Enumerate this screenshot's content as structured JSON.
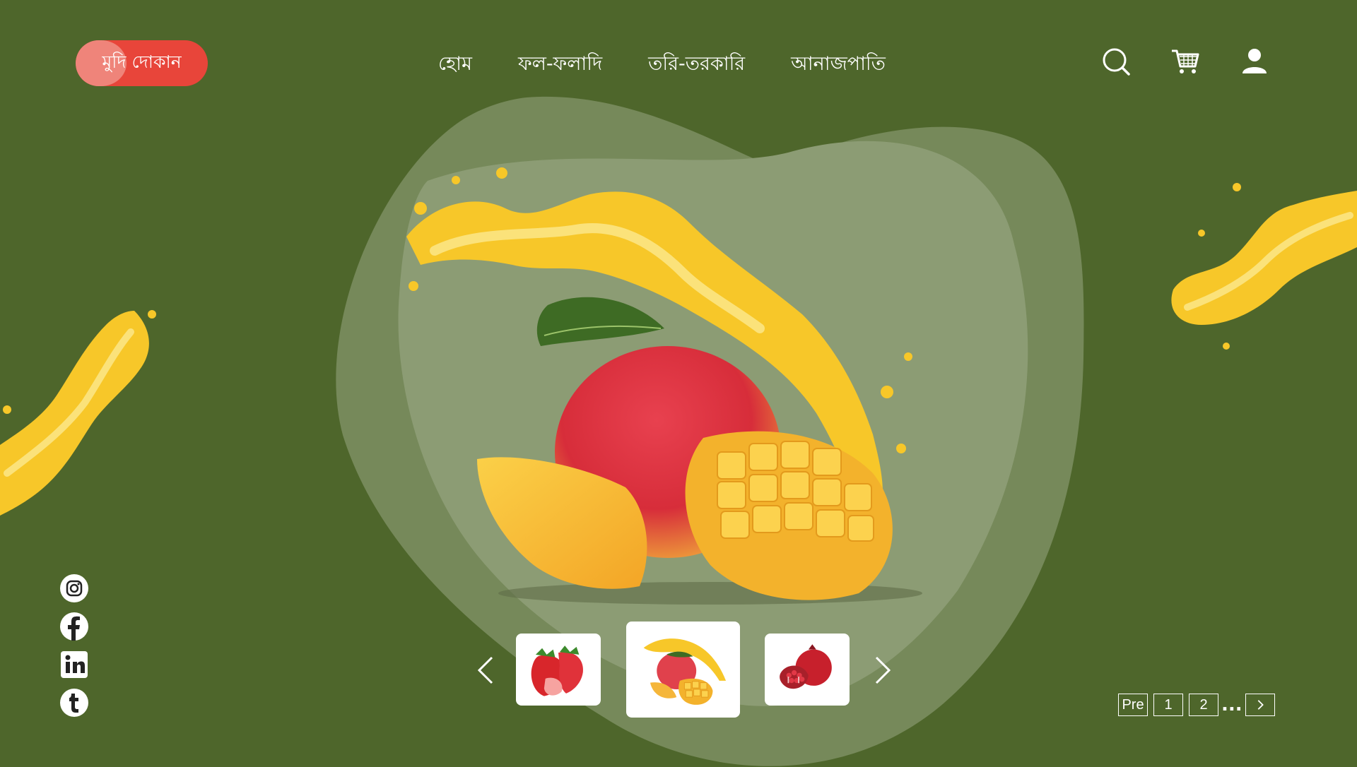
{
  "brand": {
    "name": "মুদি দোকান"
  },
  "nav": [
    {
      "label": "হোম"
    },
    {
      "label": "ফল-ফলাদি"
    },
    {
      "label": "তরি-তরকারি"
    },
    {
      "label": "আনাজপাতি"
    }
  ],
  "header_icons": [
    "search-icon",
    "cart-icon",
    "user-icon"
  ],
  "hero": {
    "product": "mango"
  },
  "carousel": {
    "items": [
      {
        "name": "strawberry"
      },
      {
        "name": "mango",
        "selected": true
      },
      {
        "name": "pomegranate"
      }
    ]
  },
  "social": [
    "instagram-icon",
    "facebook-icon",
    "linkedin-icon",
    "tumblr-icon"
  ],
  "pagination": {
    "prev": "Pre",
    "pages": [
      "1",
      "2"
    ],
    "ellipsis": "...",
    "next_icon": "chevron-right-icon"
  },
  "colors": {
    "background": "#4e662b",
    "brand": "#e8453a",
    "accent": "#f5c518"
  }
}
